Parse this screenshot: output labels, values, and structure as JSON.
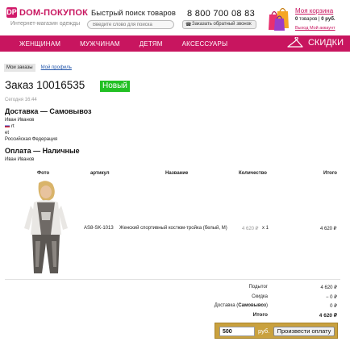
{
  "header": {
    "logo_icon": "DP",
    "logo_text": "DOM-ПОКУПОК",
    "logo_subtitle": "Интернет-магазин одежды",
    "search_title": "Быстрый поиск товаров",
    "search_placeholder": "Введите слово для поиска",
    "phone": "8 800 700 08 83",
    "callback_label": "Заказать обратный звонок",
    "cart": {
      "title": "Моя корзина",
      "items_count": "0",
      "items_label": "товаров",
      "separator": "|",
      "total": "0 руб.",
      "logout": "Выход Мой аккаунт"
    }
  },
  "nav": {
    "items": [
      {
        "label": "ЖЕНЩИНАМ"
      },
      {
        "label": "МУЖЧИНАМ"
      },
      {
        "label": "ДЕТЯМ"
      },
      {
        "label": "АКСЕССУАРЫ"
      }
    ],
    "sale_label": "СКИДКИ",
    "sale_icon": "hanger-icon"
  },
  "tabs": {
    "orders": "Мои заказы",
    "profile": "Мой профиль"
  },
  "order": {
    "title": "Заказ 10016535",
    "status": "Новый",
    "time": "Сегодня 16:44",
    "delivery_title": "Доставка — Самовывоз",
    "delivery_name": "Иван Иванов",
    "delivery_line1": "rt",
    "delivery_line2": "et",
    "delivery_country": "Российская Федерация",
    "payment_title": "Оплата — Наличные",
    "payment_name": "Иван Иванов"
  },
  "table": {
    "headers": {
      "photo": "Фото",
      "article": "артикул",
      "name": "Название",
      "qty": "Количество",
      "total": "Итого"
    },
    "rows": [
      {
        "article": "AS8-SK-1013",
        "name": "Женский спортивный костюм-тройка (белый, M)",
        "unit_price": "4 620 ₽",
        "qty": "x 1",
        "total": "4 620 ₽"
      }
    ]
  },
  "summary": {
    "subtotal_label": "Подытог",
    "subtotal_value": "4 620 ₽",
    "discount_label": "Скидка",
    "discount_value": "− 0 ₽",
    "delivery_label_prefix": "Доставка (",
    "delivery_label_method": "Самовывоз",
    "delivery_label_suffix": ")",
    "delivery_value": "0 ₽",
    "total_label": "Итого",
    "total_value": "4 620 ₽"
  },
  "payment": {
    "amount": "500",
    "currency": "руб.",
    "button_label": "Произвести оплату"
  },
  "colors": {
    "brand": "#c8155f",
    "status_new": "#22c024",
    "pay_box": "#c9a13e"
  }
}
